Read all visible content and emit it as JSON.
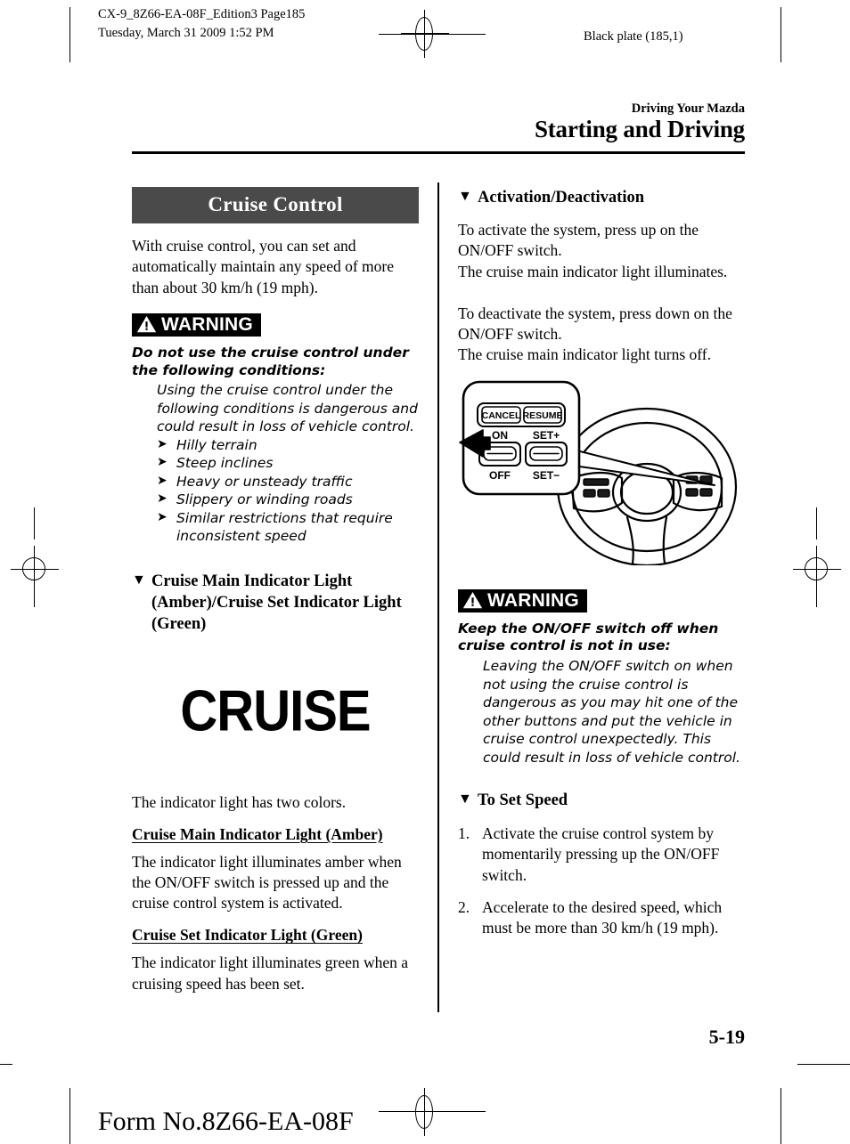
{
  "prepress": {
    "slug_line1": "CX-9_8Z66-EA-08F_Edition3 Page185",
    "slug_line2": "Tuesday, March 31 2009 1:52 PM",
    "black_plate": "Black plate (185,1)",
    "form_no": "Form No.8Z66-EA-08F"
  },
  "running_head": {
    "chapter": "Driving Your Mazda",
    "title": "Starting and Driving"
  },
  "folio": "5-19",
  "section": {
    "title": "Cruise Control",
    "intro": "With cruise control, you can set and automatically maintain any speed of more than about 30 km/h (19 mph)."
  },
  "warning_left": {
    "label": "WARNING",
    "icon": "warning-triangle-icon",
    "lead": "Do not use the cruise control under the following conditions:",
    "body": "Using the cruise control under the following conditions is dangerous and could result in loss of vehicle control.",
    "bullet_glyph": "➤",
    "items": [
      "Hilly terrain",
      "Steep inclines",
      "Heavy or unsteady traffic",
      "Slippery or winding roads",
      "Similar restrictions that require inconsistent speed"
    ]
  },
  "indicator_section": {
    "marker": "▼",
    "heading": "Cruise Main Indicator Light (Amber)/Cruise Set Indicator Light (Green)",
    "art_text": "CRUISE",
    "two_colors": "The indicator light has two colors.",
    "amber_heading": "Cruise Main Indicator Light (Amber)",
    "amber_body": "The indicator light illuminates amber when the ON/OFF switch is pressed up and the cruise control system is activated.",
    "green_heading": "Cruise Set Indicator Light (Green)",
    "green_body": "The indicator light illuminates green when a cruising speed has been set."
  },
  "activation": {
    "marker": "▼",
    "heading": "Activation/Deactivation",
    "para1": "To activate the system, press up on the ON/OFF switch.\nThe cruise main indicator light illuminates.",
    "para2": "To deactivate the system, press down on the ON/OFF switch.\nThe cruise main indicator light turns off."
  },
  "figure": {
    "name": "steering-wheel-cruise-switches-figure",
    "callout_buttons": {
      "cancel": "CANCEL",
      "resume": "RESUME",
      "on": "ON",
      "off": "OFF",
      "set_plus": "SET+",
      "set_minus": "SET−"
    }
  },
  "warning_right": {
    "label": "WARNING",
    "icon": "warning-triangle-icon",
    "lead": "Keep the ON/OFF switch off when cruise control is not in use:",
    "body": "Leaving the ON/OFF switch on when not using the cruise control is dangerous as you may hit one of the other buttons and put the vehicle in cruise control unexpectedly. This could result in loss of vehicle control."
  },
  "set_speed": {
    "marker": "▼",
    "heading": "To Set Speed",
    "steps": [
      {
        "num": "1.",
        "text": "Activate the cruise control system by momentarily pressing up the ON/OFF switch."
      },
      {
        "num": "2.",
        "text": "Accelerate to the desired speed, which must be more than 30 km/h (19 mph)."
      }
    ]
  },
  "colors": {
    "band_bg": "#4a4a4a",
    "warning_bg": "#000000",
    "text": "#000000"
  }
}
